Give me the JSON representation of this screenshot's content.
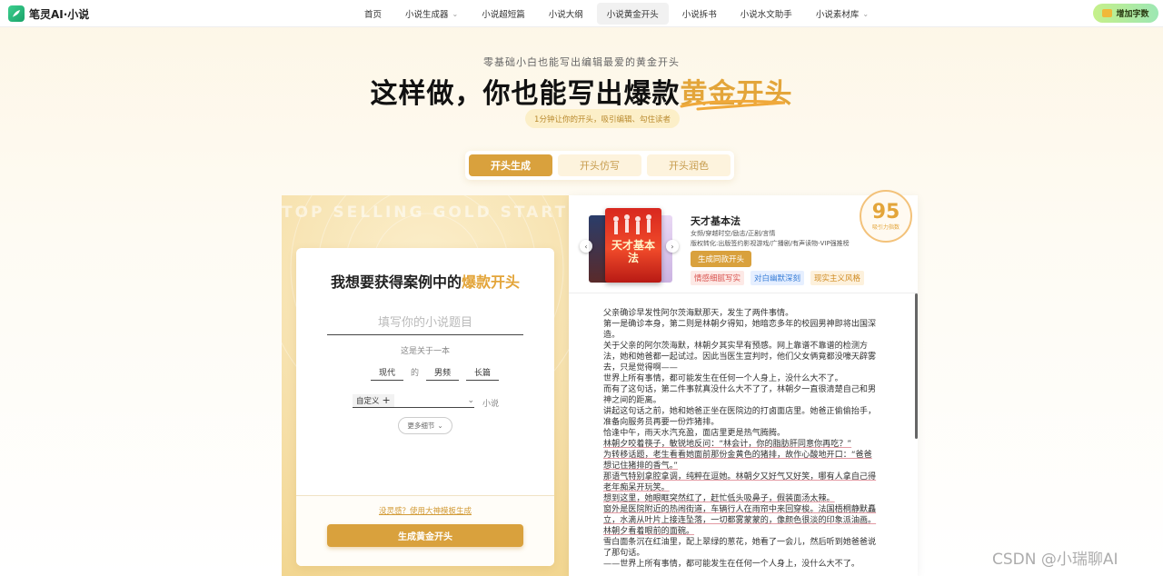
{
  "brand": {
    "name": "笔灵AI·小说"
  },
  "nav": {
    "items": [
      {
        "label": "首页",
        "has_dropdown": false,
        "active": false
      },
      {
        "label": "小说生成器",
        "has_dropdown": true,
        "active": false
      },
      {
        "label": "小说超短篇",
        "has_dropdown": false,
        "active": false
      },
      {
        "label": "小说大纲",
        "has_dropdown": false,
        "active": false
      },
      {
        "label": "小说黄金开头",
        "has_dropdown": false,
        "active": true
      },
      {
        "label": "小说拆书",
        "has_dropdown": false,
        "active": false
      },
      {
        "label": "小说水文助手",
        "has_dropdown": false,
        "active": false
      },
      {
        "label": "小说素材库",
        "has_dropdown": true,
        "active": false
      }
    ],
    "add_words_label": "增加字数"
  },
  "hero": {
    "subtitle": "零基础小白也能写出编辑最爱的黄金开头",
    "title_plain": "这样做，你也能写出爆款",
    "title_highlight": "黄金开头",
    "tip": "1分钟让你的开头，吸引编辑、勾住读者"
  },
  "modes": {
    "tabs": [
      "开头生成",
      "开头仿写",
      "开头润色"
    ],
    "active_index": 0
  },
  "form": {
    "bg_text": "TOP SELLING GOLD START",
    "title_plain": "我想要获得案例中的",
    "title_highlight": "爆款开头",
    "title_placeholder": "填写你的小说题目",
    "about_label": "这是关于一本",
    "setting": "现代",
    "de": "的",
    "channel": "男频",
    "length": "长篇",
    "custom_label": "自定义",
    "novel_label": "小说",
    "more_label": "更多细节",
    "template_link": "没灵感？使用大神模板生成",
    "generate_button": "生成黄金开头"
  },
  "book": {
    "title": "天才基本法",
    "meta_line1": "女频/穿越时空/励志/正剧/言情",
    "meta_line2": "版权转化:出版签约影视游戏/广播剧/有声读物-VIP强推榜",
    "generate_similar": "生成同款开头",
    "tags": [
      "情感细腻写实",
      "对白幽默深刻",
      "现实主义风格"
    ],
    "score": "95",
    "score_label": "吸引力指数",
    "cover_text": "天才基本法"
  },
  "story": {
    "lines": [
      {
        "text": "父亲确诊早发性阿尔茨海默那天，发生了两件事情。",
        "hl": false
      },
      {
        "text": "第一是确诊本身，第二则是林朝夕得知，她暗恋多年的校园男神即将出国深造。",
        "hl": false
      },
      {
        "text": "关于父亲的阿尔茨海默，林朝夕其实早有预感。网上靠谱不靠谱的检测方法，她和她爸都一起试过。因此当医生宣判时，他们父女俩竟都没嚎天辟雾去，只是觉得啊——",
        "hl": false
      },
      {
        "text": "世界上所有事情，都可能发生在任何一个人身上，没什么大不了。",
        "hl": false
      },
      {
        "text": "而有了这句话，第二件事就真没什么大不了了，林朝夕一直很清楚自己和男神之间的距离。",
        "hl": false
      },
      {
        "text": "讲起这句话之前，她和她爸正坐在医院边的打卤面店里。她爸正偷偷抬手，准备向服务员再要一份炸猪排。",
        "hl": false
      },
      {
        "text": "恰逢中午，雨天水汽充盈，面店里更是热气腾腾。",
        "hl": false
      },
      {
        "text": "林朝夕咬着筷子，敏锐地反问：“林会计，你的脂肪肝同意你再吃？”",
        "hl": true
      },
      {
        "text": "为转移话题，老生看看她面前那份金黄色的猪排，故作心酸地开口：“爸爸想记住猪排的香气。”",
        "hl": true
      },
      {
        "text": "那语气特别拿腔拿调，纯粹在逗她。林朝夕又好气又好笑，哪有人拿自己得老年痴呆开玩笑。",
        "hl": true
      },
      {
        "text": "想到这里，她眼眶突然红了，赶忙低头吸鼻子，假装面汤太辣。",
        "hl": true
      },
      {
        "text": "窗外是医院附近的热闹街道，车辆行人在雨帘中来回穿梭。法国梧桐静默矗立，水滴从叶片上接连坠落，一切都雾蒙蒙的，像颜色很淡的印象派油画。",
        "hl": true
      },
      {
        "text": "林朝夕看着眼前的面碗。",
        "hl": true
      },
      {
        "text": "雪白面条沉在红油里，配上翠绿的葱花，她看了一会儿，然后听到她爸爸说了那句话。",
        "hl": false
      },
      {
        "text": "——世界上所有事情，都可能发生在任何一个人身上，没什么大不了。",
        "hl": false
      }
    ]
  },
  "watermark": "CSDN @小瑞聊AI",
  "colors": {
    "accent": "#d9a13d",
    "gold_text": "#e3a53a",
    "brand_green": "#1aa36a"
  }
}
